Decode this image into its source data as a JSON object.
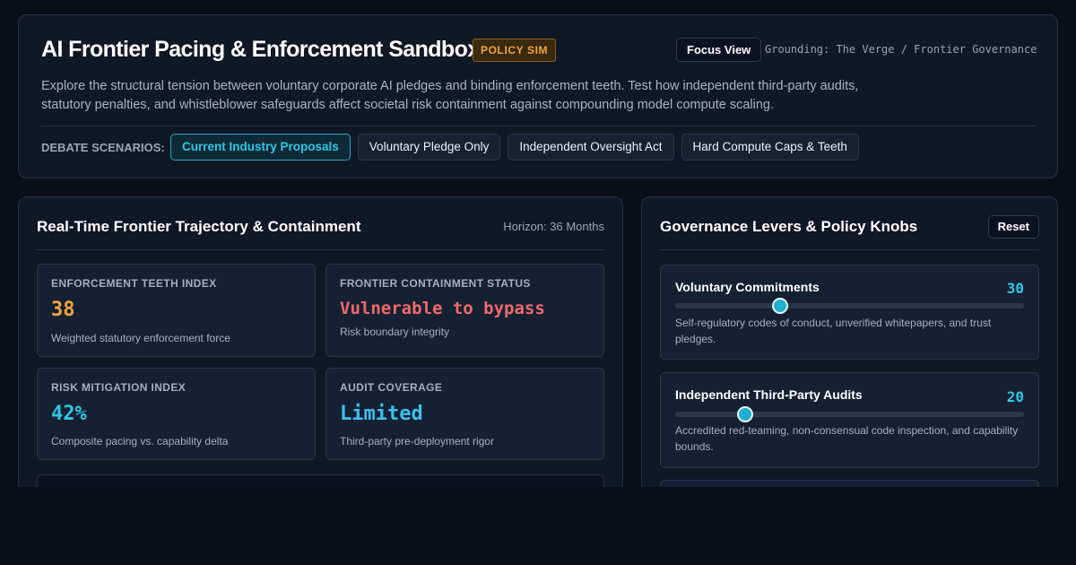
{
  "header": {
    "title": "AI Frontier Pacing & Enforcement Sandbox",
    "badge": "POLICY SIM",
    "focus_button": "Focus View",
    "grounding": "Grounding: The Verge / Frontier Governance",
    "description": "Explore the structural tension between voluntary corporate AI pledges and binding enforcement teeth. Test how independent third-party audits, statutory penalties, and whistleblower safeguards affect societal risk containment against compounding model compute scaling.",
    "scenarios_label": "DEBATE SCENARIOS:",
    "scenarios": [
      {
        "label": "Current Industry Proposals",
        "active": true
      },
      {
        "label": "Voluntary Pledge Only",
        "active": false
      },
      {
        "label": "Independent Oversight Act",
        "active": false
      },
      {
        "label": "Hard Compute Caps & Teeth",
        "active": false
      }
    ]
  },
  "trajectory": {
    "title": "Real-Time Frontier Trajectory & Containment",
    "horizon": "Horizon: 36 Months",
    "metrics": [
      {
        "label": "ENFORCEMENT TEETH INDEX",
        "value": "38",
        "sub": "Weighted statutory enforcement force",
        "color": "#f0a53a"
      },
      {
        "label": "FRONTIER CONTAINMENT STATUS",
        "value": "Vulnerable to bypass",
        "sub": "Risk boundary integrity",
        "color": "#f06a6a"
      },
      {
        "label": "RISK MITIGATION INDEX",
        "value": "42%",
        "sub": "Composite pacing vs. capability delta",
        "color": "#2fc7e4"
      },
      {
        "label": "AUDIT COVERAGE",
        "value": "Limited",
        "sub": "Third-party pre-deployment rigor",
        "color": "#3cc0ee"
      }
    ]
  },
  "levers": {
    "title": "Governance Levers & Policy Knobs",
    "reset": "Reset",
    "items": [
      {
        "title": "Voluntary Commitments",
        "value": "30",
        "level": 0.3,
        "desc": "Self-regulatory codes of conduct, unverified whitepapers, and trust pledges."
      },
      {
        "title": "Independent Third-Party Audits",
        "value": "20",
        "level": 0.2,
        "desc": "Accredited red-teaming, non-consensual code inspection, and capability bounds."
      }
    ]
  }
}
